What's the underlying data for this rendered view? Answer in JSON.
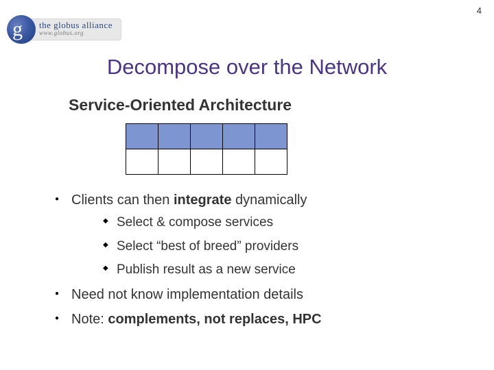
{
  "page_number": "4",
  "logo": {
    "g": "g",
    "main": "the globus alliance",
    "sub": "www.globus.org"
  },
  "title": "Decompose over the Network",
  "subtitle": "Service-Oriented Architecture",
  "bullets": {
    "b1_pre": "Clients can then ",
    "b1_strong": "integrate",
    "b1_post": " dynamically",
    "b1_sub": [
      "Select & compose services",
      "Select “best of breed” providers",
      "Publish result as a new service"
    ],
    "b2": "Need not know implementation details",
    "b3_pre": "Note: ",
    "b3_strong": "complements, not replaces, HPC"
  }
}
